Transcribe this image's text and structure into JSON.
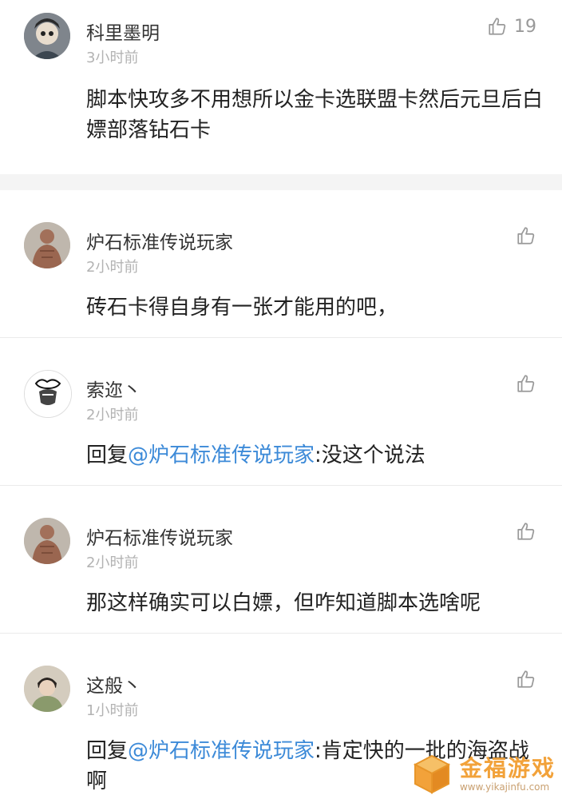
{
  "comments": [
    {
      "user": "科里墨明",
      "time": "3小时前",
      "text": "脚本快攻多不用想所以金卡选联盟卡然后元旦后白嫖部落钻石卡",
      "likes": "19"
    },
    {
      "user": "炉石标准传说玩家",
      "time": "2小时前",
      "text": "砖石卡得自身有一张才能用的吧，"
    },
    {
      "user": "索迩丶",
      "time": "2小时前",
      "reply_prefix": "回复",
      "mention": "@炉石标准传说玩家",
      "reply_text": ":没这个说法"
    },
    {
      "user": "炉石标准传说玩家",
      "time": "2小时前",
      "text": "那这样确实可以白嫖，但咋知道脚本选啥呢"
    },
    {
      "user": "这般丶",
      "time": "1小时前",
      "reply_prefix": "回复",
      "mention": "@炉石标准传说玩家",
      "reply_text": ":肯定快的一批的海盗战啊"
    }
  ],
  "icons": {
    "like": "thumbs-up-icon"
  },
  "colors": {
    "mention": "#3c8ad8",
    "watermark": "#f2a23a"
  },
  "watermark": {
    "title": "金福游戏",
    "url": "www.yikajinfu.com"
  }
}
